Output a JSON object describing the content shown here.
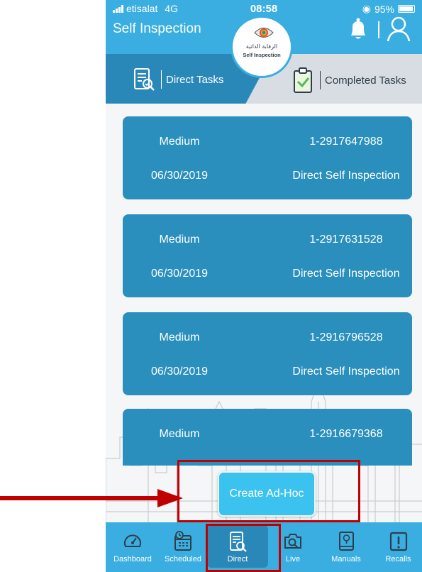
{
  "status_bar": {
    "carrier": "etisalat",
    "network": "4G",
    "time": "08:58",
    "battery": "95%"
  },
  "header": {
    "title": "Self Inspection"
  },
  "logo": {
    "arabic_text": "الرقابة الذاتية",
    "english_text": "Self Inspection"
  },
  "tabs": [
    {
      "label": "Direct Tasks",
      "active": true
    },
    {
      "label": "Completed Tasks",
      "active": false
    }
  ],
  "tasks": [
    {
      "priority": "Medium",
      "id": "1-2917647988",
      "date": "06/30/2019",
      "type": "Direct Self Inspection"
    },
    {
      "priority": "Medium",
      "id": "1-2917631528",
      "date": "06/30/2019",
      "type": "Direct Self Inspection"
    },
    {
      "priority": "Medium",
      "id": "1-2916796528",
      "date": "06/30/2019",
      "type": "Direct Self Inspection"
    },
    {
      "priority": "Medium",
      "id": "1-2916679368"
    }
  ],
  "create_adhoc_label": "Create Ad-Hoc",
  "nav": [
    {
      "label": "Dashboard",
      "icon": "gauge-icon"
    },
    {
      "label": "Scheduled",
      "icon": "calendar-clock-icon"
    },
    {
      "label": "Direct",
      "icon": "checklist-icon",
      "active": true
    },
    {
      "label": "Live",
      "icon": "live-camera-search-icon"
    },
    {
      "label": "Manuals",
      "icon": "manual-book-icon"
    },
    {
      "label": "Recalls",
      "icon": "exclamation-icon"
    }
  ],
  "colors": {
    "primary": "#3aaee1",
    "card": "#2a8fbd",
    "active": "#2a88b8",
    "annotation": "#c00000",
    "button": "#3cc2ef"
  }
}
